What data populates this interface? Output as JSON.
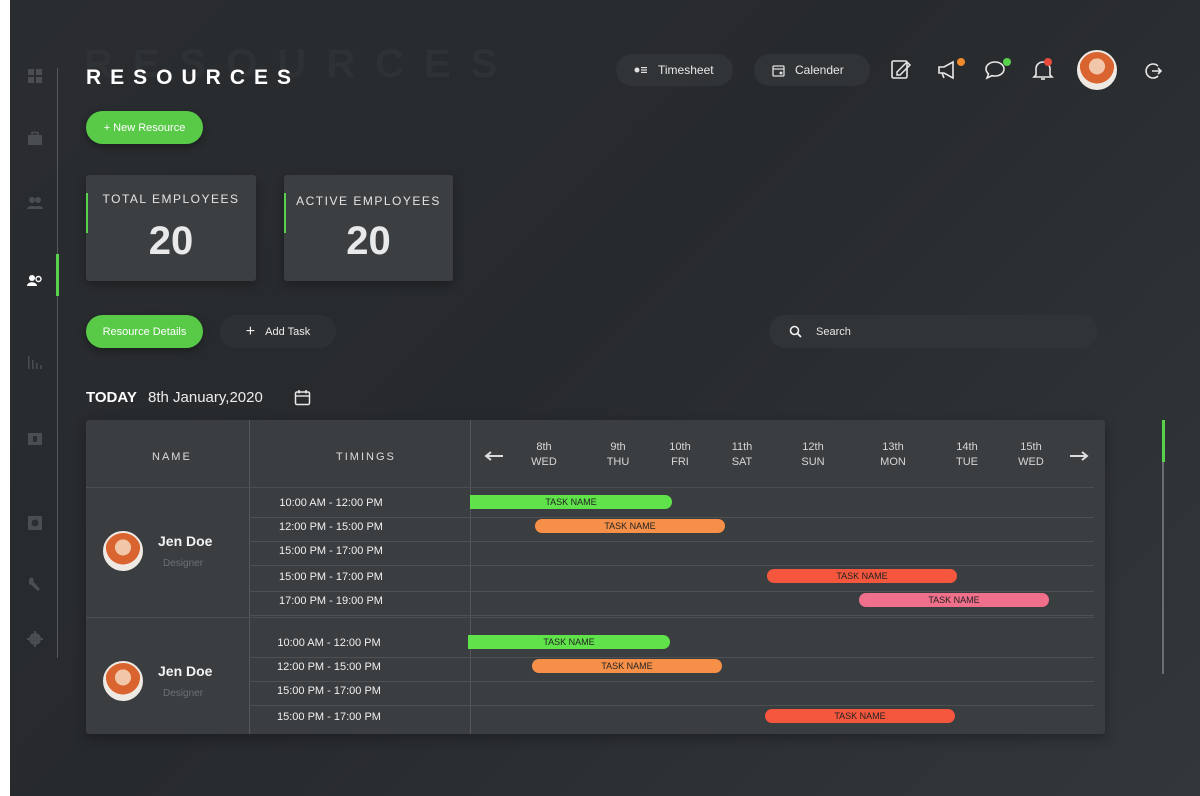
{
  "header": {
    "ghost_title": "RESOURCES",
    "title": "RESOURCES",
    "timesheet_label": "Timesheet",
    "calendar_label": "Calender",
    "accent_color": "#59c948",
    "notification_dots": {
      "announcements": "#f08a2c",
      "chat": "#59d14c",
      "alerts": "#e84a3c"
    }
  },
  "sidebar": {
    "items": [
      {
        "icon": "dashboard-icon"
      },
      {
        "icon": "briefcase-icon"
      },
      {
        "icon": "team-icon"
      },
      {
        "icon": "resources-icon",
        "active": true
      },
      {
        "icon": "analytics-icon"
      },
      {
        "icon": "billing-icon"
      },
      {
        "icon": "disc-icon"
      },
      {
        "icon": "wrench-icon"
      },
      {
        "icon": "settings-icon"
      }
    ]
  },
  "actions": {
    "new_resource": "+ New Resource"
  },
  "stats": [
    {
      "label": "TOTAL EMPLOYEES",
      "value": "20"
    },
    {
      "label": "ACTIVE EMPLOYEES",
      "value": "20"
    }
  ],
  "tabs": {
    "resource_details": "Resource Details",
    "add_task": "Add Task"
  },
  "search": {
    "placeholder": "Search"
  },
  "today": {
    "label": "TODAY",
    "date": "8th January,2020"
  },
  "table": {
    "col_name": "NAME",
    "col_timings": "TIMINGS",
    "days": [
      {
        "date": "8th",
        "day": "WED"
      },
      {
        "date": "9th",
        "day": "THU"
      },
      {
        "date": "10th",
        "day": "FRI"
      },
      {
        "date": "11th",
        "day": "SAT"
      },
      {
        "date": "12th",
        "day": "SUN"
      },
      {
        "date": "13th",
        "day": "MON"
      },
      {
        "date": "14th",
        "day": "TUE"
      },
      {
        "date": "15th",
        "day": "WED"
      }
    ],
    "people": [
      {
        "name": "Jen Doe",
        "role": "Designer",
        "rows": [
          {
            "time": "10:00 AM - 12:00 PM",
            "task": "TASK NAME",
            "color": "#5fe24a"
          },
          {
            "time": "12:00 PM - 15:00 PM",
            "task": "TASK NAME",
            "color": "#f69048"
          },
          {
            "time": "15:00 PM - 17:00 PM",
            "task": "",
            "color": ""
          },
          {
            "time": "15:00 PM - 17:00 PM",
            "task": "TASK NAME",
            "color": "#f4573d"
          },
          {
            "time": "17:00 PM - 19:00 PM",
            "task": "TASK NAME",
            "color": "#f06f8b"
          }
        ]
      },
      {
        "name": "Jen Doe",
        "role": "Designer",
        "rows": [
          {
            "time": "10:00 AM - 12:00 PM",
            "task": "TASK NAME",
            "color": "#5fe24a"
          },
          {
            "time": "12:00 PM - 15:00 PM",
            "task": "TASK NAME",
            "color": "#f69048"
          },
          {
            "time": "15:00 PM - 17:00 PM",
            "task": "",
            "color": ""
          },
          {
            "time": "15:00 PM - 17:00 PM",
            "task": "TASK NAME",
            "color": "#f4573d"
          }
        ]
      }
    ]
  }
}
